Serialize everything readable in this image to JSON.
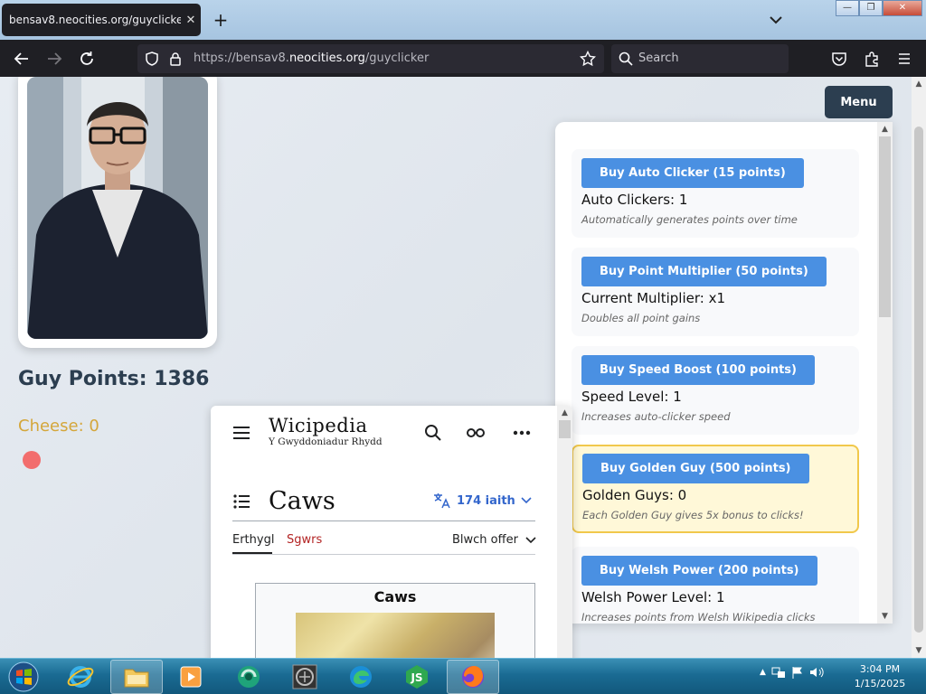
{
  "browser": {
    "tab_title": "bensav8.neocities.org/guyclicker",
    "url_prefix": "https://bensav8.",
    "url_domain": "neocities.org",
    "url_path": "/guyclicker",
    "search_placeholder": "Search"
  },
  "game": {
    "points_label": "Guy Points: 1386",
    "cheese_label": "Cheese: 0",
    "menu_label": "Menu",
    "upgrades": [
      {
        "button": "Buy Auto Clicker (15 points)",
        "level": "Auto Clickers: 1",
        "desc": "Automatically generates points over time"
      },
      {
        "button": "Buy Point Multiplier (50 points)",
        "level": "Current Multiplier: x1",
        "desc": "Doubles all point gains"
      },
      {
        "button": "Buy Speed Boost (100 points)",
        "level": "Speed Level: 1",
        "desc": "Increases auto-clicker speed"
      },
      {
        "button": "Buy Golden Guy (500 points)",
        "level": "Golden Guys: 0",
        "desc": "Each Golden Guy gives 5x bonus to clicks!"
      },
      {
        "button": "Buy Welsh Power (200 points)",
        "level": "Welsh Power Level: 1",
        "desc": "Increases points from Welsh Wikipedia clicks"
      }
    ]
  },
  "wiki": {
    "logo": "Wicipedia",
    "tagline": "Y Gwyddoniadur Rhydd",
    "title": "Caws",
    "languages": "174 iaith",
    "tab_article": "Erthygl",
    "tab_talk": "Sgwrs",
    "tools": "Blwch offer",
    "infobox_title": "Caws"
  },
  "taskbar": {
    "time": "3:04 PM",
    "date": "1/15/2025"
  },
  "colors": {
    "buy_button": "#4a90e2",
    "menu_button": "#2c3e50",
    "cheese": "#d4a63a",
    "golden_border": "#f1c84b"
  }
}
